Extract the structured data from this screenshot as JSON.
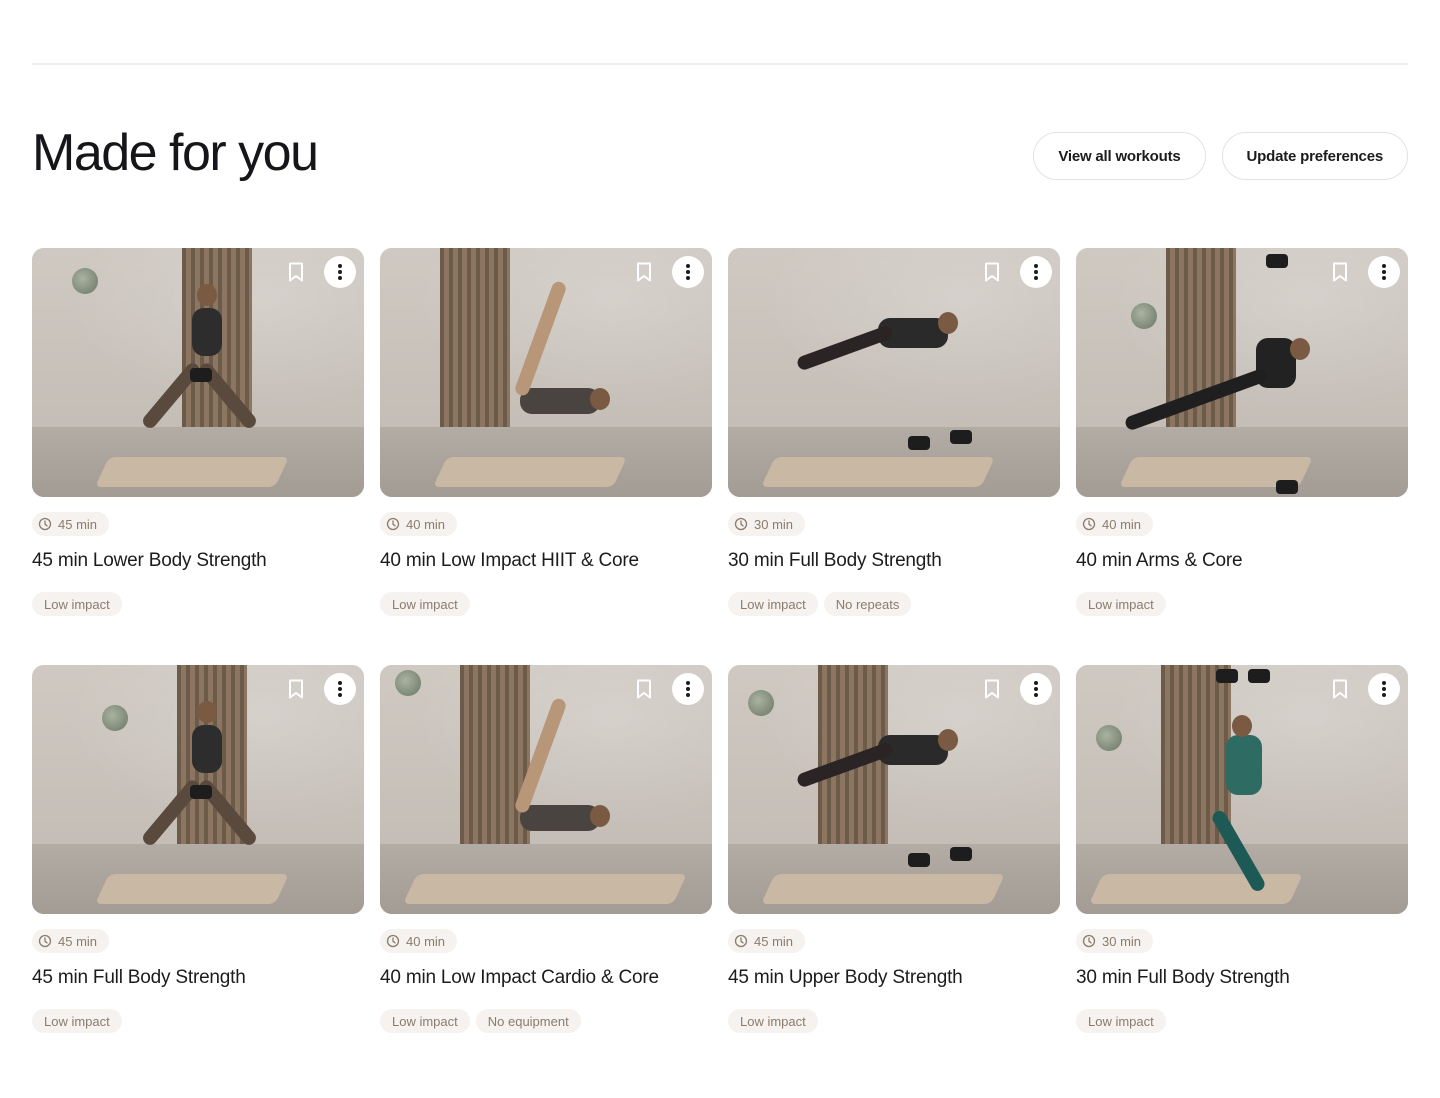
{
  "header": {
    "title": "Made for you",
    "view_all_label": "View all workouts",
    "update_prefs_label": "Update preferences"
  },
  "workouts": [
    {
      "duration": "45 min",
      "title": "45 min Lower Body Strength",
      "tags": [
        "Low impact"
      ]
    },
    {
      "duration": "40 min",
      "title": "40 min Low Impact HIIT & Core",
      "tags": [
        "Low impact"
      ]
    },
    {
      "duration": "30 min",
      "title": "30 min Full Body Strength",
      "tags": [
        "Low impact",
        "No repeats"
      ]
    },
    {
      "duration": "40 min",
      "title": "40 min Arms & Core",
      "tags": [
        "Low impact"
      ]
    },
    {
      "duration": "45 min",
      "title": "45 min Full Body Strength",
      "tags": [
        "Low impact"
      ]
    },
    {
      "duration": "40 min",
      "title": "40 min Low Impact Cardio & Core",
      "tags": [
        "Low impact",
        "No equipment"
      ]
    },
    {
      "duration": "45 min",
      "title": "45 min Upper Body Strength",
      "tags": [
        "Low impact"
      ]
    },
    {
      "duration": "30 min",
      "title": "30 min Full Body Strength",
      "tags": [
        "Low impact"
      ]
    }
  ],
  "icons": {
    "bookmark": "bookmark-icon",
    "more": "more-vertical-icon",
    "clock": "clock-icon"
  },
  "colors": {
    "tag_bg": "#f5f2ef",
    "tag_text": "#8a7c6e",
    "title_text": "#16161a"
  }
}
